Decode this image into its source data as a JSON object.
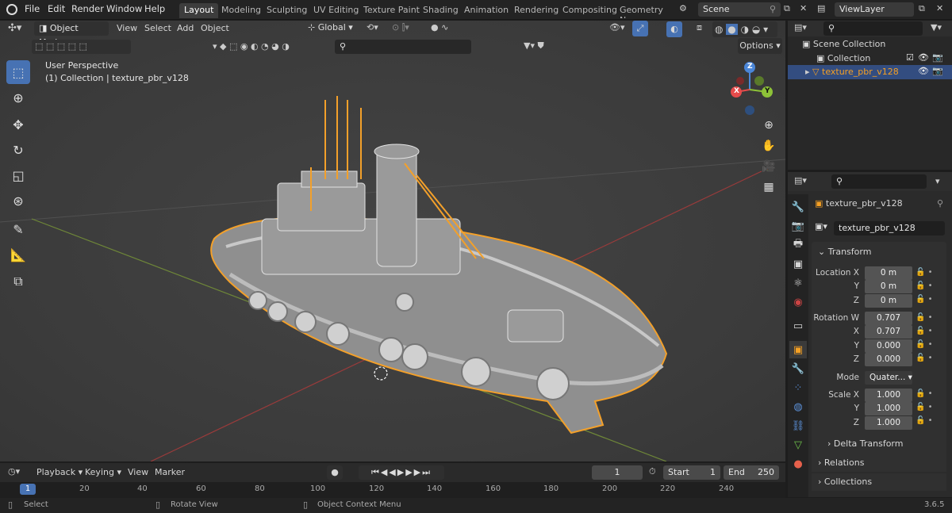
{
  "menu": {
    "file": "File",
    "edit": "Edit",
    "render": "Render",
    "window": "Window",
    "help": "Help"
  },
  "workspaces": [
    "Layout",
    "Modeling",
    "Sculpting",
    "UV Editing",
    "Texture Paint",
    "Shading",
    "Animation",
    "Rendering",
    "Compositing",
    "Geometry Noc"
  ],
  "scene": "Scene",
  "view_layer": "ViewLayer",
  "viewport_header": {
    "mode": "Object Mode",
    "view": "View",
    "select": "Select",
    "add": "Add",
    "object": "Object",
    "orientation": "Global",
    "options": "Options"
  },
  "viewport_info": {
    "line1": "User Perspective",
    "line2": "(1) Collection | texture_pbr_v128"
  },
  "gizmo": {
    "z": "Z",
    "y": "Y",
    "x": "X"
  },
  "outliner": {
    "scene_collection": "Scene Collection",
    "collection": "Collection",
    "object": "texture_pbr_v128"
  },
  "properties": {
    "object_name": "texture_pbr_v128",
    "data_name": "texture_pbr_v128",
    "transform": "Transform",
    "location_x_label": "Location X",
    "y_label": "Y",
    "z_label": "Z",
    "x_label": "X",
    "location": [
      "0 m",
      "0 m",
      "0 m"
    ],
    "rotation_w_label": "Rotation W",
    "rotation": [
      "0.707",
      "0.707",
      "0.000",
      "0.000"
    ],
    "mode_label": "Mode",
    "mode": "Quater...",
    "scale_x_label": "Scale X",
    "scale": [
      "1.000",
      "1.000",
      "1.000"
    ],
    "delta": "Delta Transform",
    "relations": "Relations",
    "collections": "Collections"
  },
  "timeline": {
    "playback": "Playback",
    "keying": "Keying",
    "view": "View",
    "marker": "Marker",
    "frame": "1",
    "start_label": "Start",
    "start": "1",
    "end_label": "End",
    "end": "250",
    "ticks": [
      "1",
      "20",
      "40",
      "60",
      "80",
      "100",
      "120",
      "140",
      "160",
      "180",
      "200",
      "220",
      "240"
    ]
  },
  "status": {
    "select": "Select",
    "rotate": "Rotate View",
    "context": "Object Context Menu",
    "version": "3.6.5"
  },
  "colors": {
    "accent": "#4772b3",
    "selection": "#f5a024",
    "axis_x": "#e54b4b",
    "axis_y": "#8dc238",
    "axis_z": "#4a86d8"
  }
}
